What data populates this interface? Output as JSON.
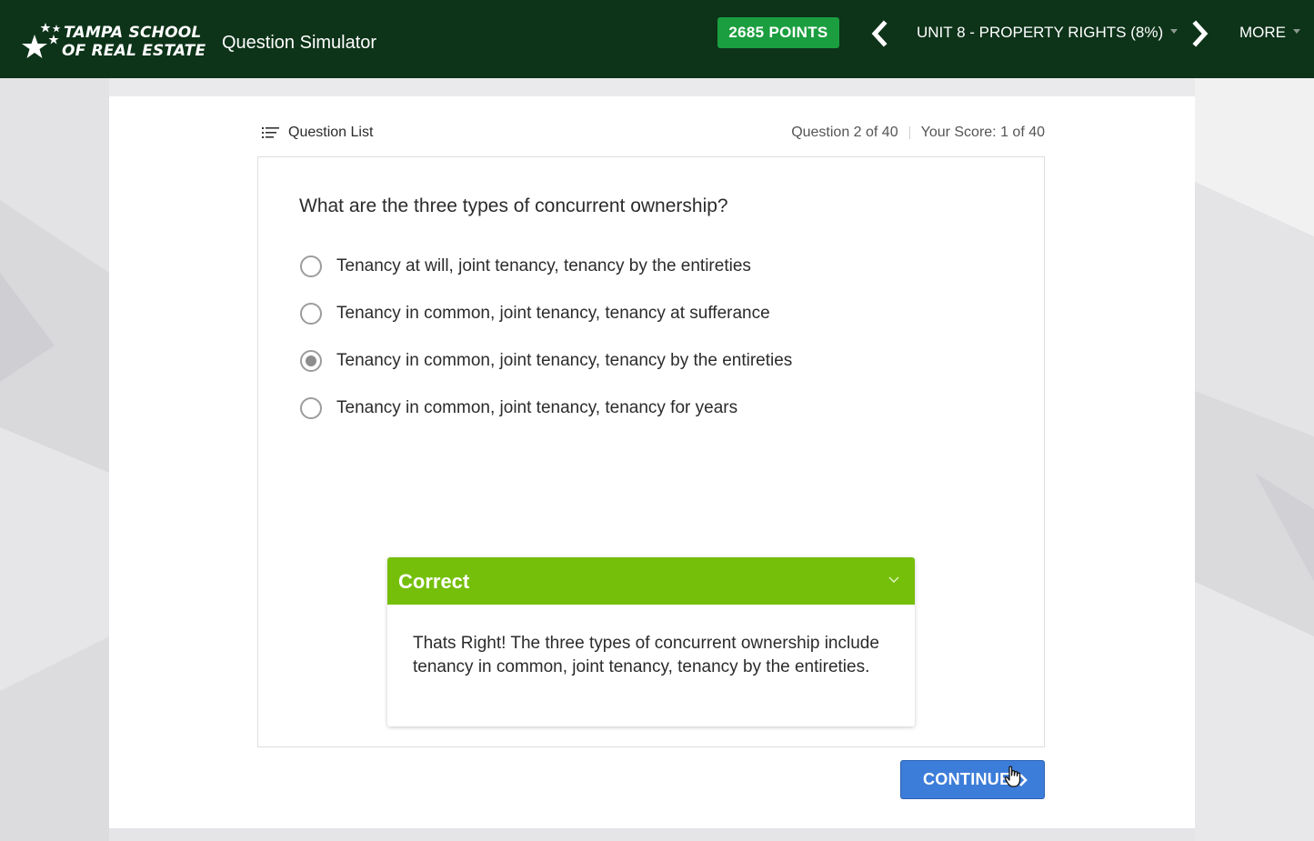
{
  "header": {
    "logo": {
      "line1": "TAMPA SCHOOL",
      "line2": "OF REAL ESTATE",
      "icon": "star-icon"
    },
    "app_title": "Question Simulator",
    "points_label": "2685 POINTS",
    "unit_label": "UNIT 8 - PROPERTY RIGHTS (8%)",
    "more_label": "MORE",
    "prev_icon": "chevron-left-icon",
    "next_icon": "chevron-right-icon",
    "colors": {
      "background": "#0d3319",
      "points_badge": "#1b9e3f"
    }
  },
  "toolbar": {
    "question_list_label": "Question List",
    "question_list_icon": "list-icon",
    "progress_label": "Question 2 of 40",
    "score_label": "Your Score: 1 of 40"
  },
  "question": {
    "text": "What are the three types of concurrent ownership?",
    "options": [
      {
        "label": "Tenancy at will, joint tenancy, tenancy by the entireties",
        "selected": false
      },
      {
        "label": "Tenancy in common, joint tenancy, tenancy at sufferance",
        "selected": false
      },
      {
        "label": "Tenancy in common, joint tenancy, tenancy by the entireties",
        "selected": true
      },
      {
        "label": "Tenancy in common, joint tenancy, tenancy for years",
        "selected": false
      }
    ]
  },
  "feedback": {
    "title": "Correct",
    "body": "Thats Right! The three types of concurrent ownership include tenancy in common, joint tenancy, tenancy by the entireties.",
    "header_color": "#75bf0a",
    "toggle_icon": "chevron-down-icon"
  },
  "actions": {
    "continue_label": "CONTINUE",
    "continue_icon": "chevron-right-icon",
    "continue_color": "#3c7dd9"
  }
}
